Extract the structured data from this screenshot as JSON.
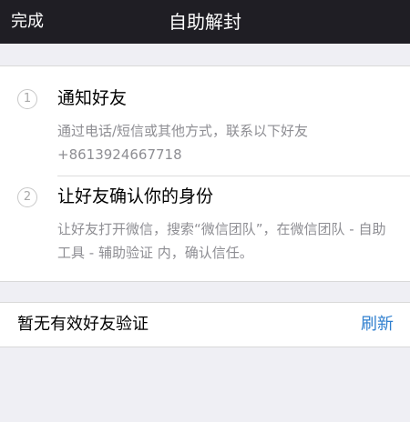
{
  "navbar": {
    "left_button": "完成",
    "title": "自助解封"
  },
  "steps": [
    {
      "number": "1",
      "title": "通知好友",
      "description": "通过电话/短信或其他方式，联系以下好友",
      "phone": "+8613924667718"
    },
    {
      "number": "2",
      "title": "让好友确认你的身份",
      "description": "让好友打开微信，搜索“微信团队”，在微信团队 - 自助工具 - 辅助验证 内，确认信任。"
    }
  ],
  "verification": {
    "status_text": "暂无有效好友验证",
    "refresh_label": "刷新"
  },
  "colors": {
    "navbar_bg": "#1f1e24",
    "page_bg": "#efeff4",
    "link": "#2f7fcf",
    "secondary_text": "#8e8e93"
  }
}
